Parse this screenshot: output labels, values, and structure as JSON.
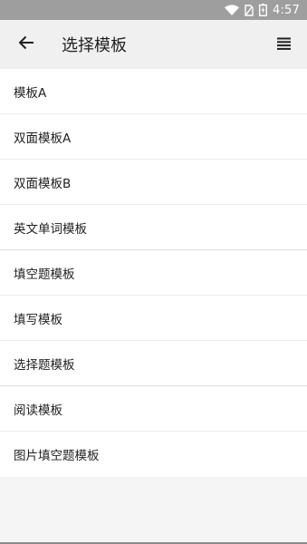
{
  "status_bar": {
    "time": "4:57",
    "icons": [
      "wifi-icon",
      "sim-icon",
      "battery-icon"
    ]
  },
  "app_bar": {
    "title": "选择模板",
    "back_icon": "arrow-back-icon",
    "menu_icon": "menu-icon"
  },
  "templates": [
    {
      "label": "模板A"
    },
    {
      "label": "双面模板A"
    },
    {
      "label": "双面模板B"
    },
    {
      "label": "英文单词模板"
    },
    {
      "label": "填空题模板"
    },
    {
      "label": "填写模板"
    },
    {
      "label": "选择题模板"
    },
    {
      "label": "阅读模板"
    },
    {
      "label": "图片填空题模板"
    }
  ],
  "colors": {
    "status_bar": "#9e9e9e",
    "app_bar": "#f0f0f0",
    "list_bg": "#ffffff",
    "page_bg": "#f5f5f5",
    "text": "#212121"
  }
}
